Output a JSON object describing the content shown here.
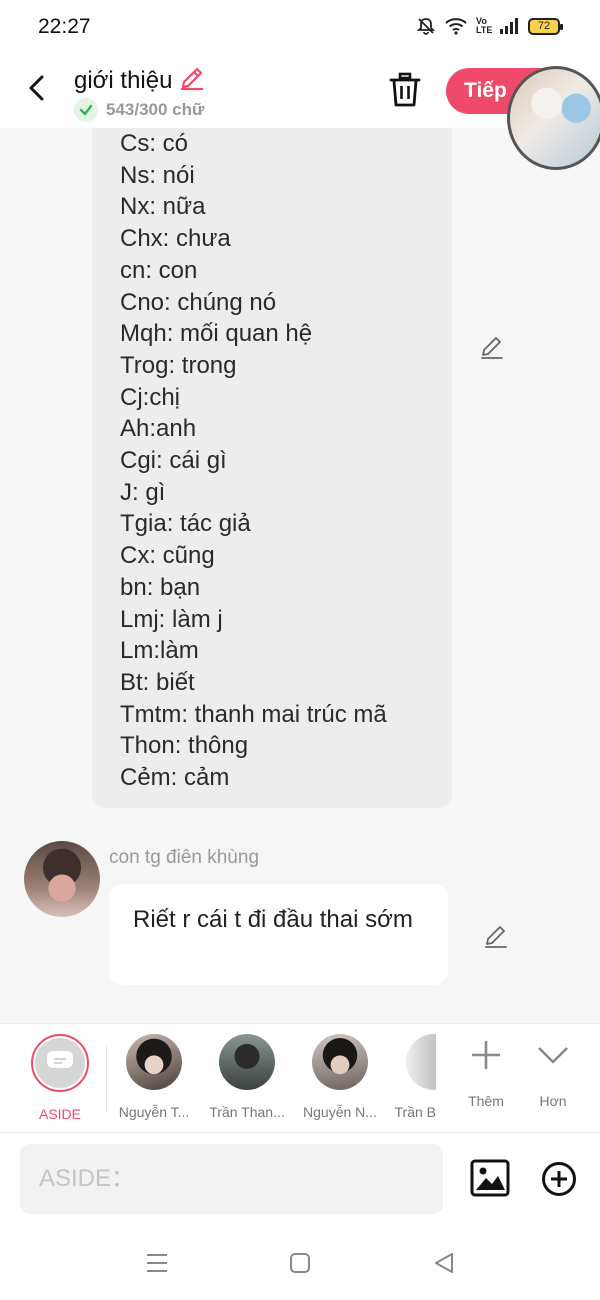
{
  "status_bar": {
    "time": "22:27",
    "battery_level": "72",
    "network_label": "Vo LTE"
  },
  "header": {
    "title": "giới thiệu",
    "word_count": "543/300 chữ",
    "next_label": "Tiếp"
  },
  "abbreviations": [
    "Cs: có",
    "Ns: nói",
    "Nx: nữa",
    "Chx: chưa",
    "cn: con",
    "Cno: chúng nó",
    "Mqh: mối quan hệ",
    "Trog: trong",
    "Cj:chị",
    "Ah:anh",
    "Cgi: cái gì",
    "J: gì",
    "Tgia: tác giả",
    "Cx: cũng",
    "bn: bạn",
    "Lmj: làm j",
    "Lm:làm",
    "Bt: biết",
    "Tmtm: thanh mai trúc mã",
    "Thon: thông",
    "Cẻm: cảm"
  ],
  "message": {
    "sender": "con tg điên khùng",
    "text": "Riết r cái t đi đầu thai sớm"
  },
  "characters": [
    {
      "label": "ASIDE",
      "selected": true
    },
    {
      "label": "Nguyễn T..."
    },
    {
      "label": "Trần Than..."
    },
    {
      "label": "Nguyễn N..."
    },
    {
      "label": "Trần B"
    }
  ],
  "character_actions": {
    "add_label": "Thêm",
    "more_label": "Hơn"
  },
  "composer": {
    "placeholder": "ASIDE："
  },
  "colors": {
    "accent": "#f04a6a",
    "bubble_gray": "#ededed",
    "background": "#f6f6f6"
  }
}
